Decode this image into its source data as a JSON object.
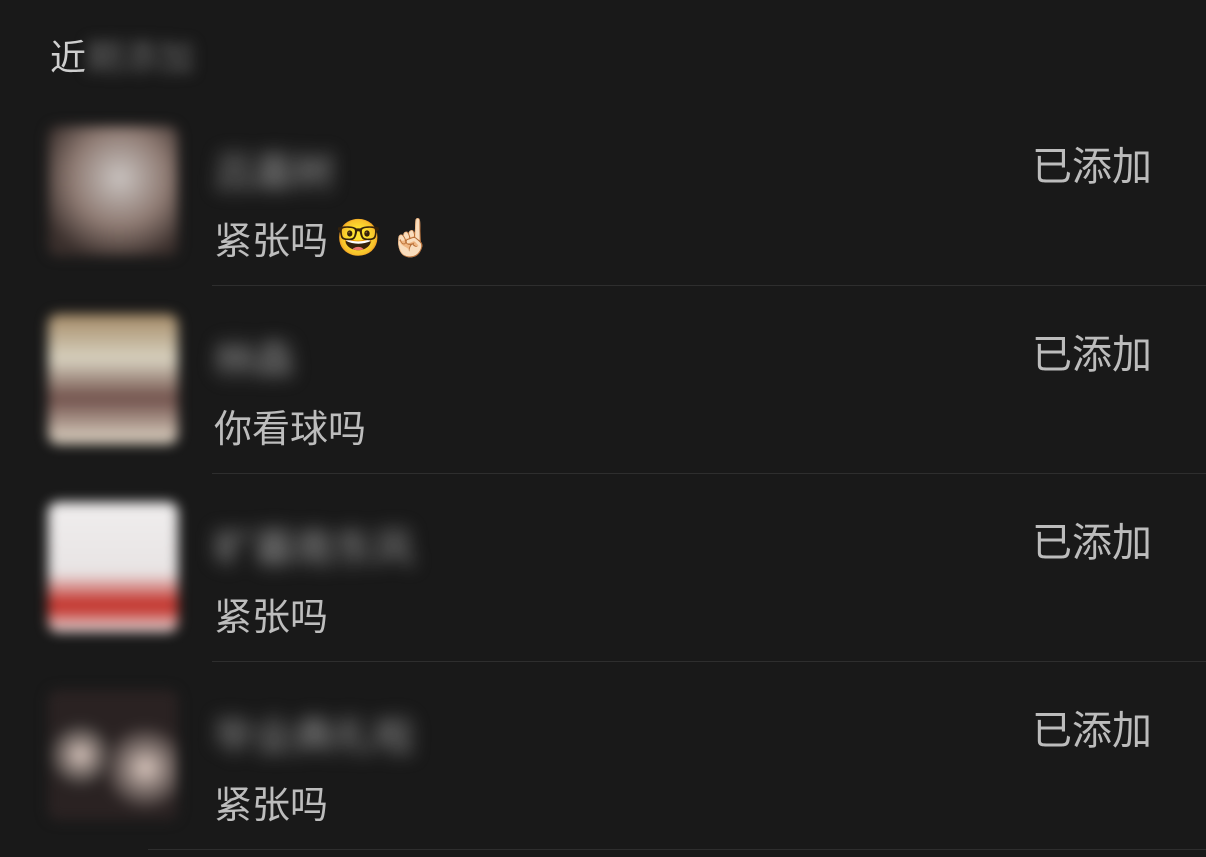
{
  "header": {
    "title_visible": "近",
    "title_blurred": "期添加"
  },
  "contacts": [
    {
      "name": "吕嘉树",
      "message": "紧张吗",
      "emojis": [
        "🤓",
        "☝🏻"
      ],
      "status": "已添加",
      "avatar_colors": [
        "#8e7a72",
        "#c9c3c0",
        "#6b5550"
      ]
    },
    {
      "name": "林森",
      "message": "你看球吗",
      "emojis": [],
      "status": "已添加",
      "avatar_colors": [
        "#a58a66",
        "#d8d2c0",
        "#70504a"
      ]
    },
    {
      "name": "旷暮南东风",
      "message": "紧张吗",
      "emojis": [],
      "status": "已添加",
      "avatar_colors": [
        "#f0eeee",
        "#e8e4e4",
        "#c0241c"
      ]
    },
    {
      "name": "毕业典礼啦",
      "message": "紧张吗",
      "emojis": [],
      "status": "已添加",
      "avatar_colors": [
        "#1e1a1a",
        "#d9c6bd",
        "#2a2222"
      ]
    }
  ]
}
